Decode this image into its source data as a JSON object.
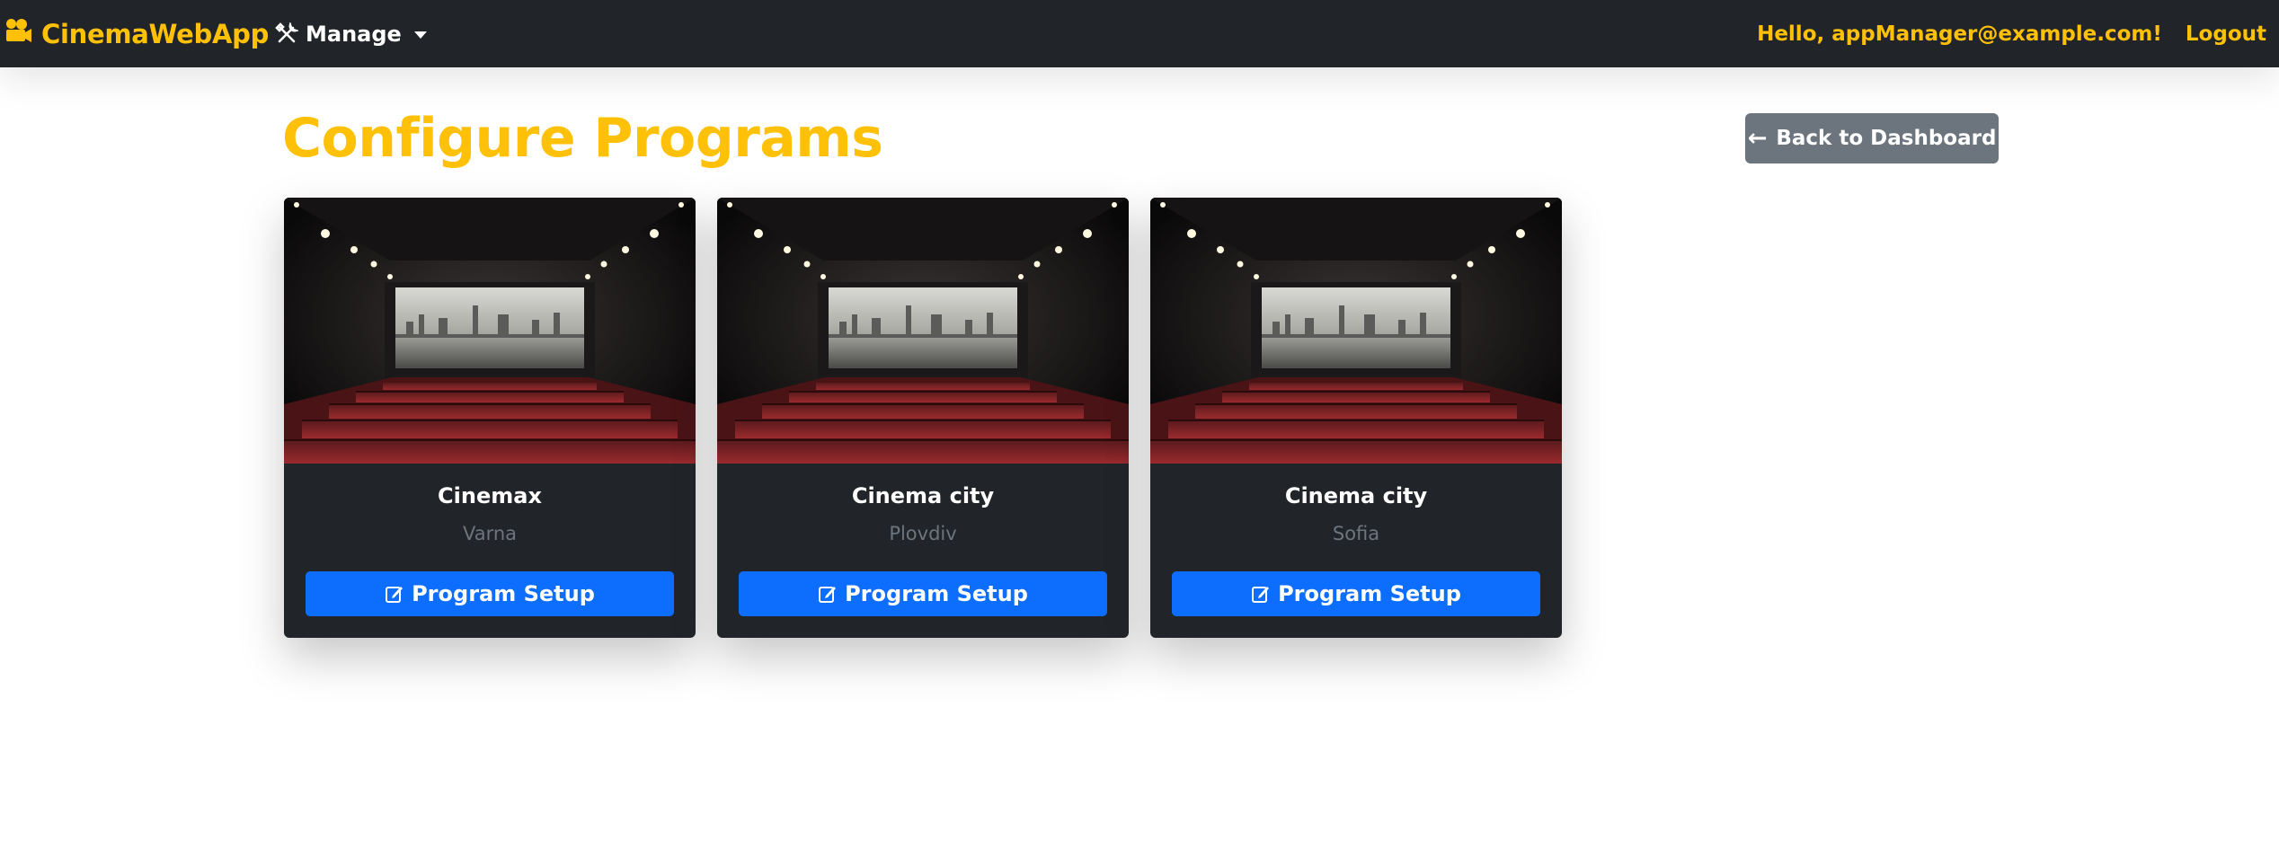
{
  "navbar": {
    "brand": "CinemaWebApp",
    "brand_icon": "video-camera-icon",
    "manage_label": "Manage",
    "manage_icon": "tools-icon",
    "greeting": "Hello, appManager@example.com!",
    "logout_label": "Logout"
  },
  "page": {
    "title": "Configure Programs",
    "back_label": "Back to Dashboard",
    "back_icon": "arrow-left-icon"
  },
  "cards": [
    {
      "name": "Cinemax",
      "city": "Varna",
      "button_label": "Program Setup",
      "image": "cinema-hall-image"
    },
    {
      "name": "Cinema city",
      "city": "Plovdiv",
      "button_label": "Program Setup",
      "image": "cinema-hall-image"
    },
    {
      "name": "Cinema city",
      "city": "Sofia",
      "button_label": "Program Setup",
      "image": "cinema-hall-image"
    }
  ],
  "colors": {
    "navbar_bg": "#212529",
    "accent": "#ffc107",
    "primary": "#0d6efd",
    "secondary": "#6c757d",
    "card_bg": "#212529"
  }
}
